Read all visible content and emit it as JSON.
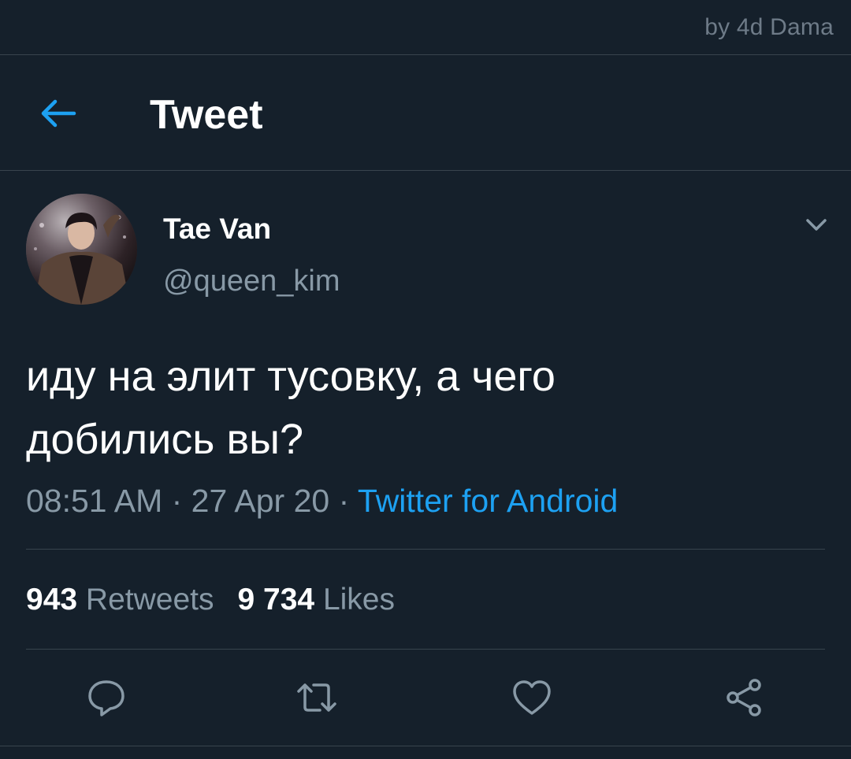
{
  "watermark": "by 4d Dama",
  "header": {
    "title": "Tweet",
    "back_icon": "arrow-left-icon"
  },
  "author": {
    "display_name": "Tae Van",
    "handle": "@queen_kim"
  },
  "tweet": {
    "line1": "иду на элит тусовку, а чего",
    "line2": "добились вы?",
    "time": "08:51 AM",
    "sep1": " · ",
    "date": "27 Apr 20",
    "sep2": " · ",
    "source": "Twitter for Android"
  },
  "stats": {
    "retweets_count": "943",
    "retweets_label": "Retweets",
    "likes_count": "9 734",
    "likes_label": "Likes"
  },
  "actions": {
    "reply_icon": "reply-icon",
    "retweet_icon": "retweet-icon",
    "like_icon": "heart-icon",
    "share_icon": "share-icon"
  },
  "colors": {
    "background": "#15202b",
    "accent": "#1da1f2",
    "secondary_text": "#8899a6",
    "divider": "#38444d"
  }
}
